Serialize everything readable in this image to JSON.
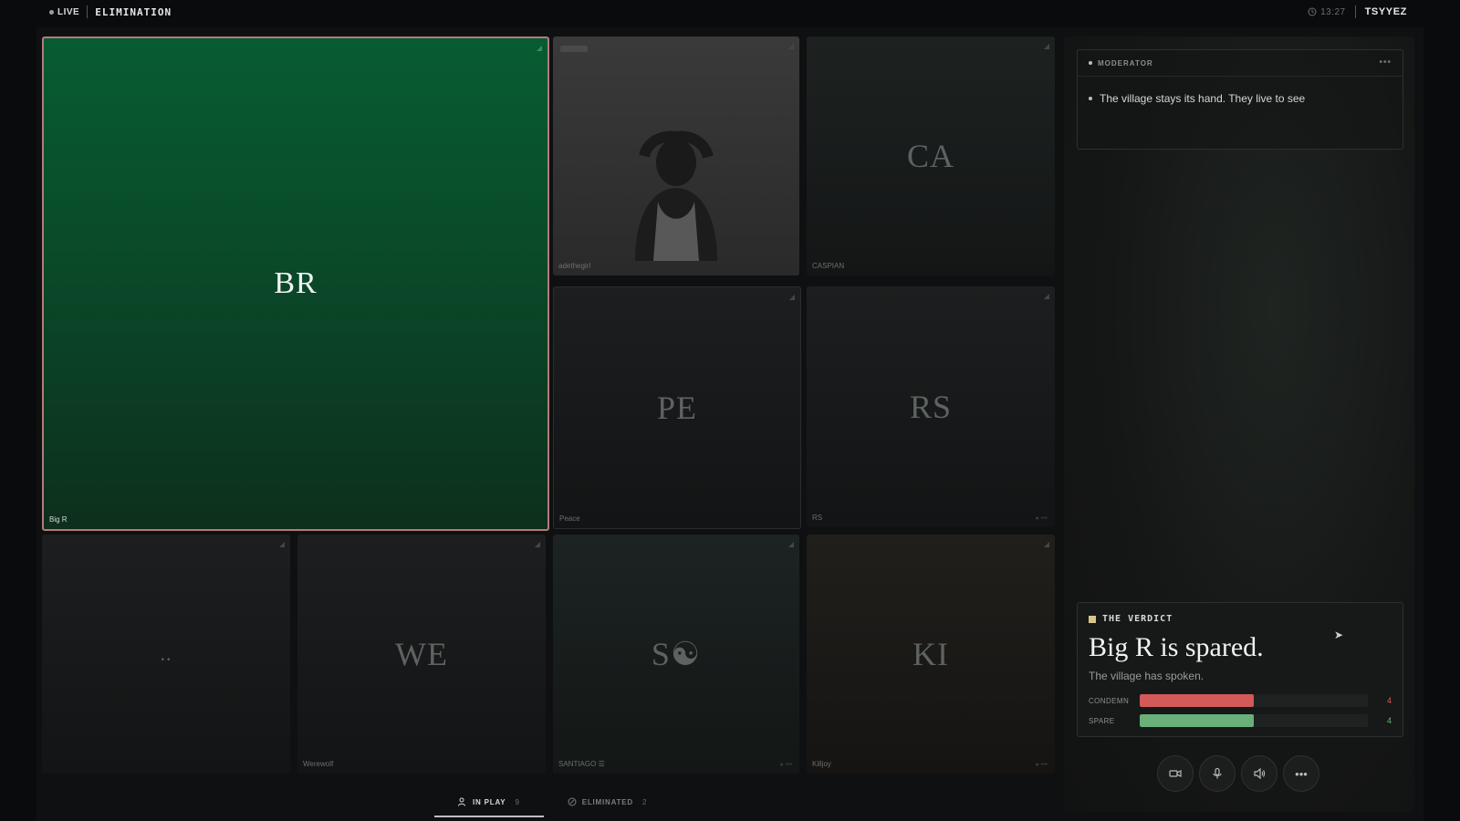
{
  "header": {
    "live_label": "LIVE",
    "phase": "ELIMINATION",
    "timer": "13:27",
    "username": "TSYYEZ"
  },
  "tiles": [
    {
      "initials": "BR",
      "name": "Big R"
    },
    {
      "initials": "",
      "name": "adethegirl"
    },
    {
      "initials": "CA",
      "name": "CASPIAN"
    },
    {
      "initials": "PE",
      "name": "Peace"
    },
    {
      "initials": "RS",
      "name": "RS"
    },
    {
      "initials": "..",
      "name": ""
    },
    {
      "initials": "WE",
      "name": "Werewolf"
    },
    {
      "initials": "S☯",
      "name": "SANTIAGO ☰"
    },
    {
      "initials": "KI",
      "name": "Killjoy"
    }
  ],
  "moderator": {
    "label": "MODERATOR",
    "message": "The village stays its hand. They live to see"
  },
  "verdict": {
    "label": "THE VERDICT",
    "title": "Big R is spared.",
    "subtitle": "The village has spoken.",
    "votes": [
      {
        "label": "CONDEMN",
        "count": "4",
        "fraction": 0.5,
        "color": "#d45a5a"
      },
      {
        "label": "SPARE",
        "count": "4",
        "fraction": 0.5,
        "color": "#69b07a"
      }
    ]
  },
  "controls": {
    "camera_icon": "video-camera-icon",
    "mic_icon": "microphone-icon",
    "speaker_icon": "speaker-icon",
    "more_icon": "more-icon"
  },
  "tabs": {
    "in_play_label": "IN PLAY",
    "in_play_count": "9",
    "eliminated_label": "ELIMINATED",
    "eliminated_count": "2"
  }
}
